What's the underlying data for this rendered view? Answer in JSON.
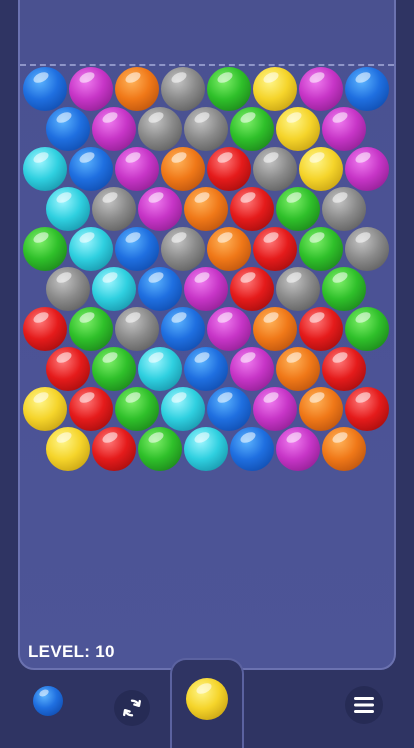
{
  "hud": {
    "level_text": "LEVEL: 10"
  },
  "colors": {
    "blue": "#1f6fe0",
    "purple": "#c735c7",
    "orange": "#f07818",
    "gray": "#8a8a8a",
    "green": "#2fc02a",
    "yellow": "#f5d42a",
    "cyan": "#2fd0e0",
    "red": "#e51b1b"
  },
  "grid": [
    [
      "blue",
      "purple",
      "orange",
      "gray",
      "green",
      "yellow",
      "purple",
      "blue"
    ],
    [
      "blue",
      "purple",
      "gray",
      "gray",
      "green",
      "yellow",
      "purple"
    ],
    [
      "cyan",
      "blue",
      "purple",
      "orange",
      "red",
      "gray",
      "yellow",
      "purple"
    ],
    [
      "cyan",
      "gray",
      "purple",
      "orange",
      "red",
      "green",
      "gray"
    ],
    [
      "green",
      "cyan",
      "blue",
      "gray",
      "orange",
      "red",
      "green",
      "gray"
    ],
    [
      "gray",
      "cyan",
      "blue",
      "purple",
      "red",
      "gray",
      "green"
    ],
    [
      "red",
      "green",
      "gray",
      "blue",
      "purple",
      "orange",
      "red",
      "green"
    ],
    [
      "red",
      "green",
      "cyan",
      "blue",
      "purple",
      "orange",
      "red"
    ],
    [
      "yellow",
      "red",
      "green",
      "cyan",
      "blue",
      "purple",
      "orange",
      "red"
    ],
    [
      "yellow",
      "red",
      "green",
      "cyan",
      "blue",
      "purple",
      "orange"
    ]
  ],
  "shooter": {
    "current_color": "yellow",
    "next_color": "blue",
    "swap_icon": "swap-icon",
    "menu_icon": "menu-icon"
  }
}
